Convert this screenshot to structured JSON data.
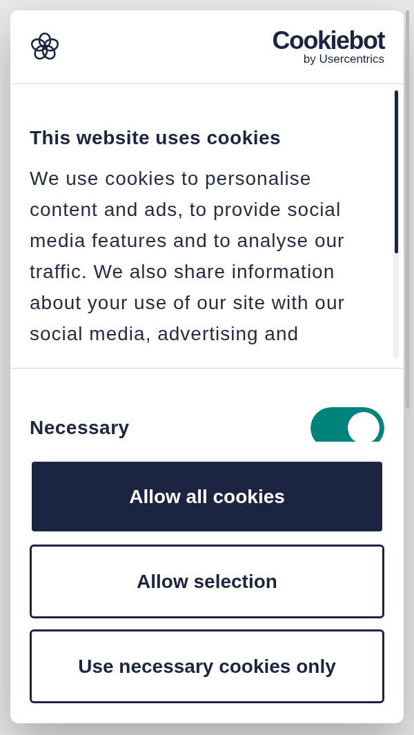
{
  "header": {
    "logo": {
      "wordmark": "Cookiebot",
      "byline": "by Usercentrics"
    }
  },
  "intro": {
    "title": "This website uses cookies",
    "body": "We use cookies to personalise content and ads, to provide social media features and to analyse our traffic. We also share information about your use of our site with our social media, advertising and"
  },
  "categories": [
    {
      "label": "Necessary",
      "on": true
    }
  ],
  "buttons": [
    {
      "label": "Allow all cookies",
      "kind": "primary"
    },
    {
      "label": "Allow selection",
      "kind": "outline"
    },
    {
      "label": "Use necessary cookies only",
      "kind": "outline"
    }
  ]
}
